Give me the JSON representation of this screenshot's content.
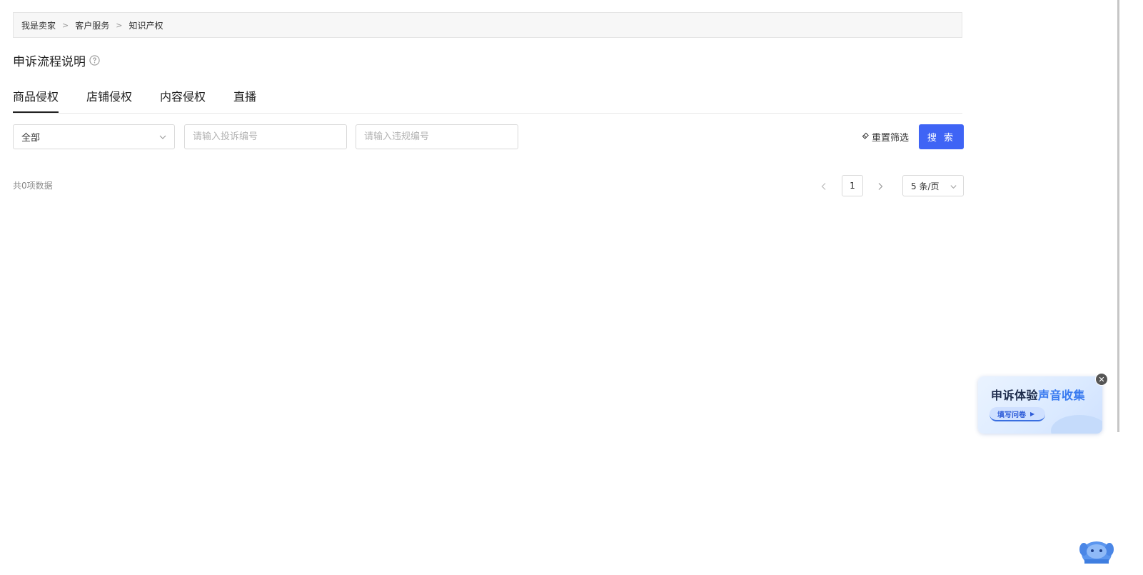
{
  "breadcrumb": {
    "items": [
      "我是卖家",
      "客户服务",
      "知识产权"
    ],
    "separator": ">"
  },
  "page": {
    "title": "申诉流程说明"
  },
  "tabs": [
    {
      "label": "商品侵权",
      "active": true
    },
    {
      "label": "店铺侵权",
      "active": false
    },
    {
      "label": "内容侵权",
      "active": false
    },
    {
      "label": "直播",
      "active": false
    }
  ],
  "filters": {
    "type_select": {
      "value": "全部"
    },
    "complaint_input": {
      "placeholder": "请输入投诉编号",
      "value": ""
    },
    "violation_input": {
      "placeholder": "请输入违规编号",
      "value": ""
    },
    "reset_label": "重置筛选",
    "search_label": "搜 索"
  },
  "results": {
    "total_text": "共0项数据"
  },
  "pagination": {
    "current_page": "1",
    "page_size_label": "5 条/页"
  },
  "promo": {
    "title_normal": "申诉体验",
    "title_highlight": "声音收集",
    "button_label": "填写问卷",
    "close_symbol": "✕"
  },
  "colors": {
    "primary": "#3f64f5",
    "promo_highlight": "#3a7bf0"
  },
  "icons": [
    "help-circle-icon",
    "chevron-down-icon",
    "eraser-icon",
    "chevron-left-icon",
    "chevron-right-icon",
    "close-icon",
    "play-icon",
    "mascot-icon"
  ]
}
